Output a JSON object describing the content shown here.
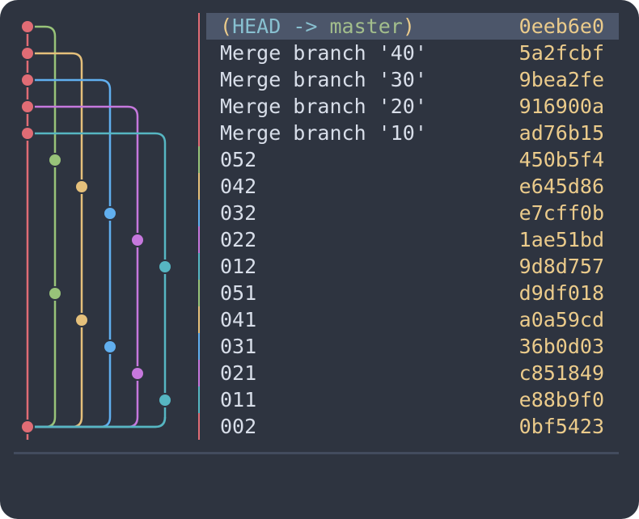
{
  "colors": {
    "background": "#2e3440",
    "selected_row": "#4c566a",
    "text": "#d8dee9",
    "hash": "#ebcb8b",
    "head_label": "#88c0d0",
    "branch_label": "#a3be8c",
    "lanes": [
      "#e06c75",
      "#98c379",
      "#e5c07b",
      "#61afef",
      "#c678dd",
      "#56b6c2"
    ]
  },
  "graph": {
    "lanes": [
      "main",
      "5x",
      "4x",
      "3x",
      "2x",
      "1x"
    ],
    "merges": [
      {
        "row": 0,
        "from_lane": 1
      },
      {
        "row": 1,
        "from_lane": 2
      },
      {
        "row": 2,
        "from_lane": 3
      },
      {
        "row": 3,
        "from_lane": 4
      },
      {
        "row": 4,
        "from_lane": 5
      }
    ],
    "fork_row": 15
  },
  "commits": [
    {
      "lane": 0,
      "refs": {
        "open": "(",
        "head": "HEAD",
        "arrow": " -> ",
        "branch": "master",
        "close": ")"
      },
      "message": "",
      "hash": "0eeb6e0",
      "selected": true
    },
    {
      "lane": 0,
      "message": "Merge branch '40'",
      "hash": "5a2fcbf"
    },
    {
      "lane": 0,
      "message": "Merge branch '30'",
      "hash": "9bea2fe"
    },
    {
      "lane": 0,
      "message": "Merge branch '20'",
      "hash": "916900a"
    },
    {
      "lane": 0,
      "message": "Merge branch '10'",
      "hash": "ad76b15"
    },
    {
      "lane": 1,
      "message": "052",
      "hash": "450b5f4"
    },
    {
      "lane": 2,
      "message": "042",
      "hash": "e645d86"
    },
    {
      "lane": 3,
      "message": "032",
      "hash": "e7cff0b"
    },
    {
      "lane": 4,
      "message": "022",
      "hash": "1ae51bd"
    },
    {
      "lane": 5,
      "message": "012",
      "hash": "9d8d757"
    },
    {
      "lane": 1,
      "message": "051",
      "hash": "d9df018"
    },
    {
      "lane": 2,
      "message": "041",
      "hash": "a0a59cd"
    },
    {
      "lane": 3,
      "message": "031",
      "hash": "36b0d03"
    },
    {
      "lane": 4,
      "message": "021",
      "hash": "c851849"
    },
    {
      "lane": 5,
      "message": "011",
      "hash": "e88b9f0"
    },
    {
      "lane": 0,
      "message": "002",
      "hash": "0bf5423"
    }
  ]
}
